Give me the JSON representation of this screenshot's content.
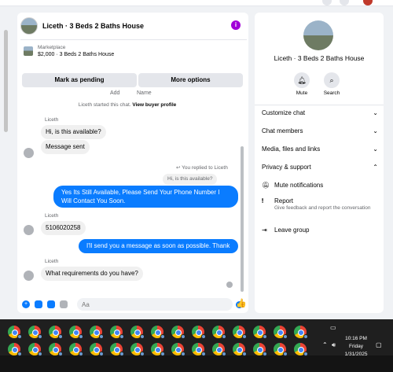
{
  "chat": {
    "title": "Liceth · 3 Beds 2 Baths House",
    "listing": {
      "category": "Marketplace",
      "detail": "$2,000 · 3 Beds 2 Baths House"
    },
    "actions": [
      "Mark as pending",
      "More options"
    ],
    "cut_off": [
      "Add",
      "Name"
    ],
    "started_text": "Liceth started this chat.",
    "started_link": "View buyer profile",
    "messages": [
      {
        "sender": "Liceth",
        "text": "Hi, is this available?"
      },
      {
        "text": "Message sent"
      },
      {
        "replied": "You replied to Liceth",
        "quote": "Hi, is this available?",
        "text": "Yes Its Still Available, Please Send Your Phone Number I Will Contact You Soon."
      },
      {
        "sender": "Liceth",
        "text": "5106020258"
      },
      {
        "text": "I'll send you a message as soon as possible. Thank you"
      },
      {
        "sender": "Liceth",
        "text": "What requirements do you have?"
      }
    ],
    "composer": {
      "placeholder": "Aa"
    },
    "colors": {
      "accent": "#0a7cff",
      "info": "#a100d8"
    }
  },
  "info_panel": {
    "name": "Liceth · 3 Beds 2 Baths House",
    "buttons": [
      {
        "icon": "bell-icon",
        "label": "Mute"
      },
      {
        "icon": "search-icon",
        "label": "Search"
      }
    ],
    "sections": [
      "Customize chat",
      "Chat members",
      "Media, files and links",
      "Privacy & support"
    ],
    "privacy_items": [
      {
        "icon": "mute-icon",
        "label": "Mute notifications"
      },
      {
        "icon": "alert-icon",
        "label": "Report",
        "sub": "Give feedback and report the conversation"
      },
      {
        "icon": "leave-icon",
        "label": "Leave group"
      }
    ]
  },
  "taskbar": {
    "time": "10:16 PM",
    "day": "Friday",
    "date": "1/31/2025"
  }
}
